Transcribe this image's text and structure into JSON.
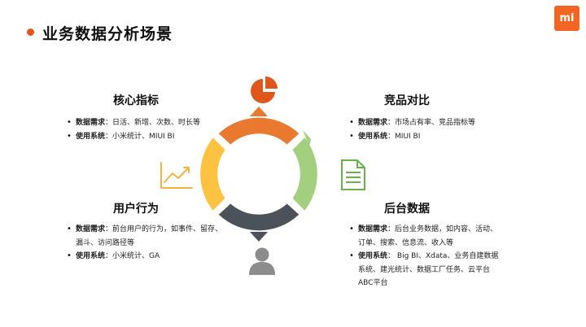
{
  "page": {
    "title": "业务数据分析场景"
  },
  "logo": {
    "text": "mi"
  },
  "sections": {
    "core": {
      "title": "核心指标",
      "items": [
        {
          "label": "数据需求",
          "sep": "：",
          "text": "日活、新增、次数、时长等"
        },
        {
          "label": "使用系统",
          "sep": "：",
          "text": "小米统计、MIUI BI"
        }
      ]
    },
    "competition": {
      "title": "竞品对比",
      "items": [
        {
          "label": "数据需求",
          "sep": "：",
          "text": "市场占有率、竞品指标等"
        },
        {
          "label": "使用系统",
          "sep": "：",
          "text": "MIUI BI"
        }
      ]
    },
    "user_behavior": {
      "title": "用户行为",
      "items": [
        {
          "label": "数据需求",
          "sep": "：",
          "text": "前台用户的行为，如事件、留存、漏斗、访问路径等"
        },
        {
          "label": "使用系统",
          "sep": "：",
          "text": "小米统计、GA"
        }
      ]
    },
    "backend": {
      "title": "后台数据",
      "items": [
        {
          "label": "数据需求",
          "sep": "：",
          "text": "后台业务数据，如内容、活动、订单、搜索、信息流、收入等"
        },
        {
          "label": "使用系统",
          "sep": "：",
          "text": " Big BI、Xdata、业务自建数据系统、建光统计、数据工厂任务、云平台ABC平台"
        }
      ]
    }
  },
  "diagram": {
    "colors": {
      "top": "#e8792f",
      "right": "#a3cf7e",
      "bottom": "#4b5259",
      "left": "#fcc240",
      "pie_icon": "#e0571b",
      "chart_icon": "#f5b33d",
      "doc_icon": "#6ab04c",
      "user_icon": "#8c8c8c"
    },
    "icons": [
      "pie-chart-icon",
      "document-icon",
      "user-icon",
      "line-chart-icon"
    ]
  }
}
